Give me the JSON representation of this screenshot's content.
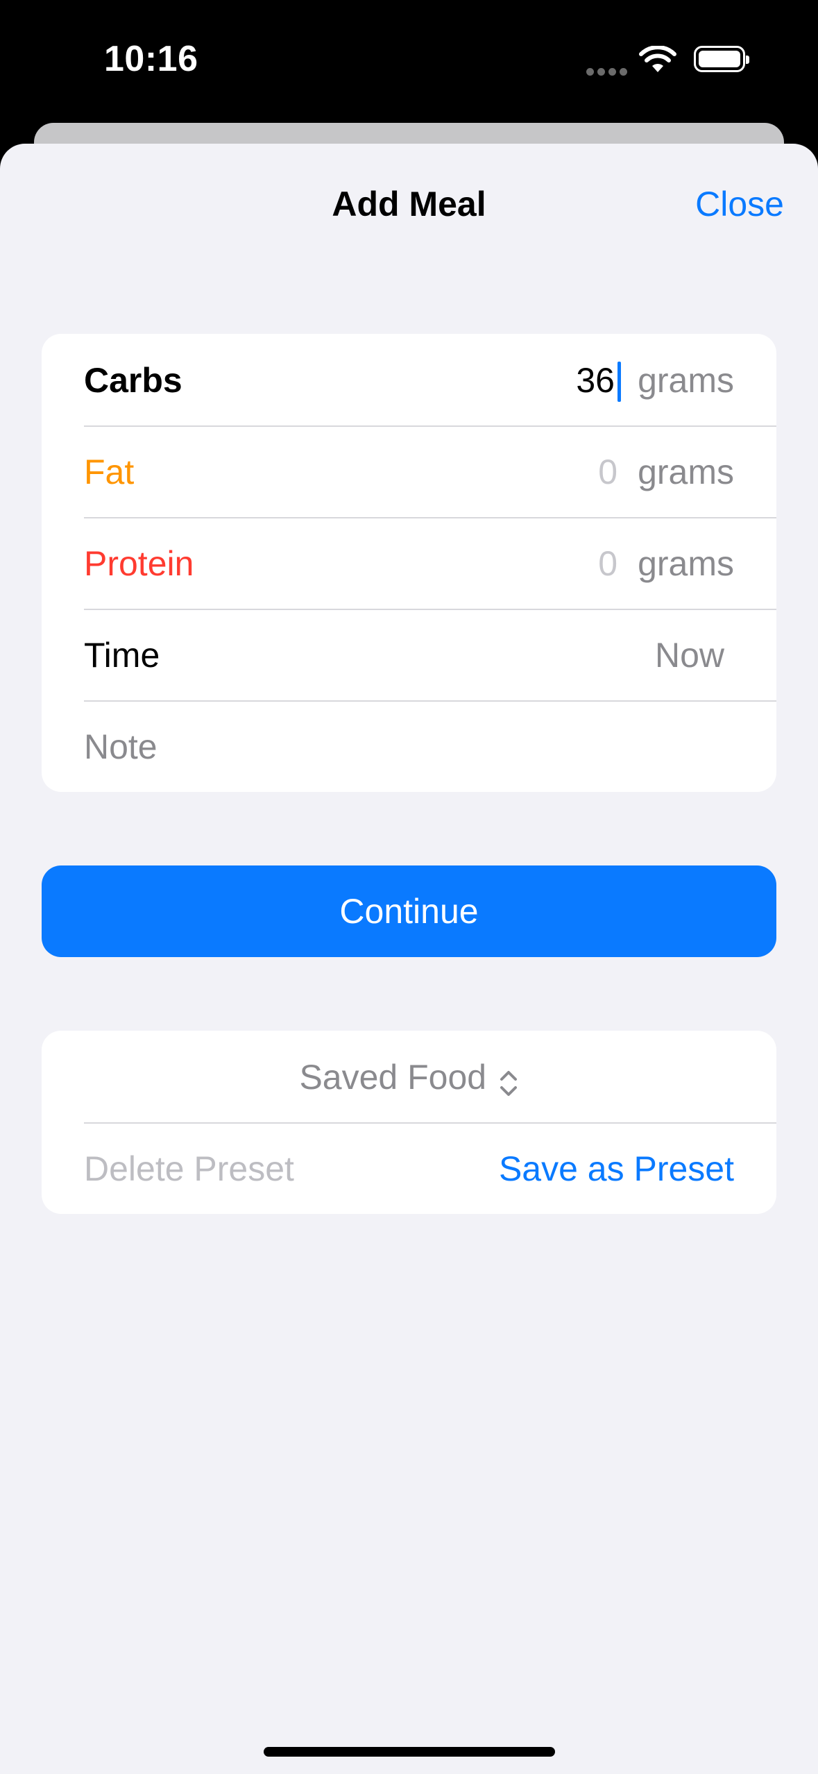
{
  "status_bar": {
    "time": "10:16"
  },
  "header": {
    "title": "Add Meal",
    "close_label": "Close"
  },
  "macros": [
    {
      "label": "Carbs",
      "value": "36",
      "unit": "grams",
      "label_color": "#000000"
    },
    {
      "label": "Fat",
      "value": "0",
      "unit": "grams",
      "label_color": "#ff9500"
    },
    {
      "label": "Protein",
      "value": "0",
      "unit": "grams",
      "label_color": "#ff3b30"
    }
  ],
  "time_row": {
    "label": "Time",
    "value": "Now"
  },
  "note": {
    "placeholder": "Note"
  },
  "continue_label": "Continue",
  "presets": {
    "picker_label": "Saved Food",
    "delete_label": "Delete Preset",
    "save_label": "Save as Preset"
  },
  "colors": {
    "accent": "#0a7aff",
    "background": "#f2f2f7"
  }
}
